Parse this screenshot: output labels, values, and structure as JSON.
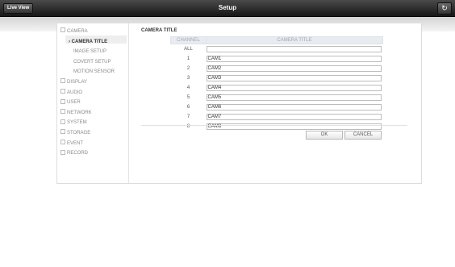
{
  "header": {
    "live_view_label": "Live View",
    "title": "Setup",
    "refresh_icon": "refresh-icon"
  },
  "sidebar": {
    "items": [
      {
        "label": "CAMERA",
        "type": "group"
      },
      {
        "label": "CAMERA TITLE",
        "type": "sub",
        "active": true
      },
      {
        "label": "IMAGE SETUP",
        "type": "sub"
      },
      {
        "label": "COVERT SETUP",
        "type": "sub"
      },
      {
        "label": "MOTION SENSOR",
        "type": "sub"
      },
      {
        "label": "DISPLAY",
        "type": "group"
      },
      {
        "label": "AUDIO",
        "type": "group"
      },
      {
        "label": "USER",
        "type": "group"
      },
      {
        "label": "NETWORK",
        "type": "group"
      },
      {
        "label": "SYSTEM",
        "type": "group"
      },
      {
        "label": "STORAGE",
        "type": "group"
      },
      {
        "label": "EVENT",
        "type": "group"
      },
      {
        "label": "RECORD",
        "type": "group"
      }
    ]
  },
  "main": {
    "section_title": "CAMERA TITLE",
    "columns": [
      "CHANNEL",
      "CAMERA TITLE"
    ],
    "rows": [
      {
        "channel": "ALL",
        "title": ""
      },
      {
        "channel": "1",
        "title": "CAM1"
      },
      {
        "channel": "2",
        "title": "CAM2"
      },
      {
        "channel": "3",
        "title": "CAM3"
      },
      {
        "channel": "4",
        "title": "CAM4"
      },
      {
        "channel": "5",
        "title": "CAM5"
      },
      {
        "channel": "6",
        "title": "CAM6"
      },
      {
        "channel": "7",
        "title": "CAM7"
      },
      {
        "channel": "8",
        "title": "CAM8"
      }
    ],
    "ok_label": "OK",
    "cancel_label": "CANCEL"
  },
  "colors": {
    "topbar": "#1e1e1e",
    "header_cell_bg": "#e8ecf0",
    "active_item_bg": "#eeeeee"
  }
}
